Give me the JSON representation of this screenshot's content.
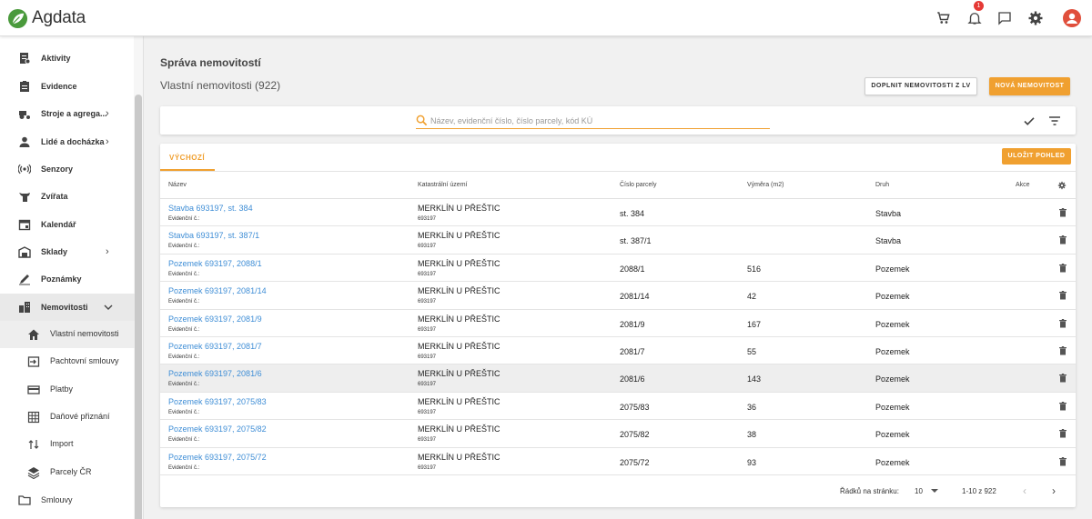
{
  "app": {
    "name": "Agdata",
    "notification_count": "1"
  },
  "sidebar": {
    "items": [
      {
        "label": "Aktivity",
        "icon": "activity-icon"
      },
      {
        "label": "Evidence",
        "icon": "clipboard-icon"
      },
      {
        "label": "Stroje a agrega...",
        "icon": "tractor-icon",
        "expandable": true
      },
      {
        "label": "Lidé a docházka",
        "icon": "person-icon",
        "expandable": true
      },
      {
        "label": "Senzory",
        "icon": "sensor-icon"
      },
      {
        "label": "Zvířata",
        "icon": "animal-icon"
      },
      {
        "label": "Kalendář",
        "icon": "calendar-icon"
      },
      {
        "label": "Sklady",
        "icon": "warehouse-icon",
        "expandable": true
      },
      {
        "label": "Poznámky",
        "icon": "pencil-icon"
      },
      {
        "label": "Nemovitosti",
        "icon": "buildings-icon",
        "expanded": true
      }
    ],
    "sub_items": [
      {
        "label": "Vlastní nemovitosti",
        "icon": "home-icon",
        "active": true
      },
      {
        "label": "Pachtovní smlouvy",
        "icon": "contract-icon"
      },
      {
        "label": "Platby",
        "icon": "card-icon"
      },
      {
        "label": "Daňové přiznání",
        "icon": "grid-icon"
      },
      {
        "label": "Import",
        "icon": "import-icon"
      },
      {
        "label": "Parcely ČR",
        "icon": "layers-icon"
      }
    ],
    "bottom_item": {
      "label": "Smlouvy",
      "icon": "folder-icon"
    }
  },
  "main": {
    "title": "Správa nemovitostí",
    "subtitle": "Vlastní nemovitosti (922)",
    "btn_fill_from_lv": "DOPLNIT NEMOVITOSTI Z LV",
    "btn_new": "NOVÁ NEMOVITOST",
    "search_placeholder": "Název, evidenční číslo, číslo parcely, kód KÚ",
    "tab_default": "VÝCHOZÍ",
    "btn_save_view": "ULOŽIT POHLED",
    "columns": {
      "name": "Název",
      "ku": "Katastrální území",
      "parcel": "Číslo parcely",
      "area": "Výměra (m2)",
      "type": "Druh",
      "actions": "Akce"
    },
    "rows": [
      {
        "name": "Stavba 693197, st. 384",
        "evid": "Evidenční č.:",
        "ku": "MERKLÍN U PŘEŠTIC",
        "ku_code": "693197",
        "parcel": "st. 384",
        "area": "",
        "type": "Stavba"
      },
      {
        "name": "Stavba 693197, st. 387/1",
        "evid": "Evidenční č.:",
        "ku": "MERKLÍN U PŘEŠTIC",
        "ku_code": "693197",
        "parcel": "st. 387/1",
        "area": "",
        "type": "Stavba"
      },
      {
        "name": "Pozemek 693197, 2088/1",
        "evid": "Evidenční č.:",
        "ku": "MERKLÍN U PŘEŠTIC",
        "ku_code": "693197",
        "parcel": "2088/1",
        "area": "516",
        "type": "Pozemek"
      },
      {
        "name": "Pozemek 693197, 2081/14",
        "evid": "Evidenční č.:",
        "ku": "MERKLÍN U PŘEŠTIC",
        "ku_code": "693197",
        "parcel": "2081/14",
        "area": "42",
        "type": "Pozemek"
      },
      {
        "name": "Pozemek 693197, 2081/9",
        "evid": "Evidenční č.:",
        "ku": "MERKLÍN U PŘEŠTIC",
        "ku_code": "693197",
        "parcel": "2081/9",
        "area": "167",
        "type": "Pozemek"
      },
      {
        "name": "Pozemek 693197, 2081/7",
        "evid": "Evidenční č.:",
        "ku": "MERKLÍN U PŘEŠTIC",
        "ku_code": "693197",
        "parcel": "2081/7",
        "area": "55",
        "type": "Pozemek"
      },
      {
        "name": "Pozemek 693197, 2081/6",
        "evid": "Evidenční č.:",
        "ku": "MERKLÍN U PŘEŠTIC",
        "ku_code": "693197",
        "parcel": "2081/6",
        "area": "143",
        "type": "Pozemek",
        "highlighted": true
      },
      {
        "name": "Pozemek 693197, 2075/83",
        "evid": "Evidenční č.:",
        "ku": "MERKLÍN U PŘEŠTIC",
        "ku_code": "693197",
        "parcel": "2075/83",
        "area": "36",
        "type": "Pozemek"
      },
      {
        "name": "Pozemek 693197, 2075/82",
        "evid": "Evidenční č.:",
        "ku": "MERKLÍN U PŘEŠTIC",
        "ku_code": "693197",
        "parcel": "2075/82",
        "area": "38",
        "type": "Pozemek"
      },
      {
        "name": "Pozemek 693197, 2075/72",
        "evid": "Evidenční č.:",
        "ku": "MERKLÍN U PŘEŠTIC",
        "ku_code": "693197",
        "parcel": "2075/72",
        "area": "93",
        "type": "Pozemek"
      }
    ],
    "pager": {
      "rows_per_page_label": "Řádků na stránku:",
      "rows_per_page": "10",
      "range": "1-10 z 922"
    }
  },
  "colors": {
    "accent": "#f0a030",
    "link": "#3f8ed6",
    "logo_green": "#4a9a3c",
    "avatar": "#e04f3c",
    "badge": "#e53935"
  }
}
